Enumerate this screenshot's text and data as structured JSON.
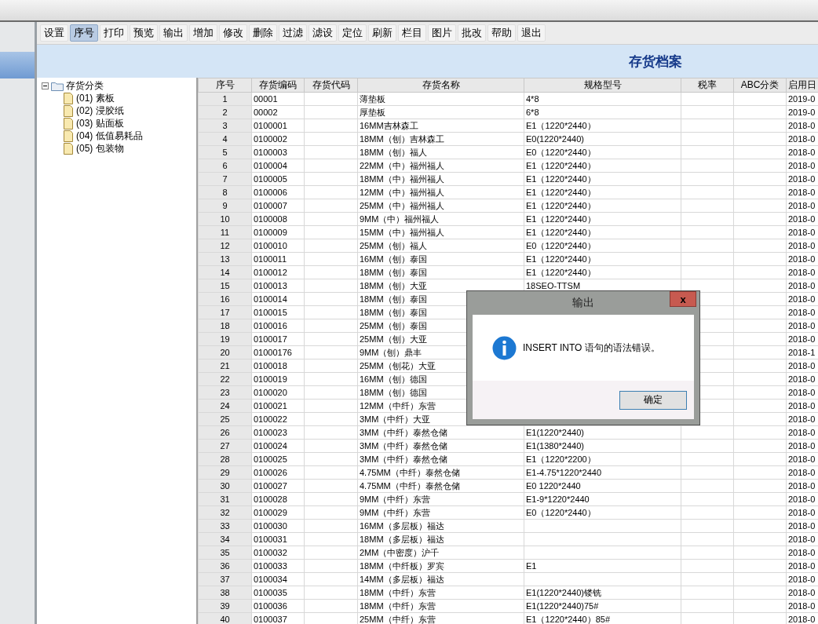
{
  "toolbar": [
    {
      "label": "设置",
      "selected": false
    },
    {
      "label": "序号",
      "selected": true
    },
    {
      "label": "打印",
      "selected": false
    },
    {
      "label": "预览",
      "selected": false
    },
    {
      "label": "输出",
      "selected": false
    },
    {
      "label": "增加",
      "selected": false
    },
    {
      "label": "修改",
      "selected": false
    },
    {
      "label": "删除",
      "selected": false
    },
    {
      "label": "过滤",
      "selected": false
    },
    {
      "label": "滤设",
      "selected": false
    },
    {
      "label": "定位",
      "selected": false
    },
    {
      "label": "刷新",
      "selected": false
    },
    {
      "label": "栏目",
      "selected": false
    },
    {
      "label": "图片",
      "selected": false
    },
    {
      "label": "批改",
      "selected": false
    },
    {
      "label": "帮助",
      "selected": false
    },
    {
      "label": "退出",
      "selected": false
    }
  ],
  "title": "存货档案",
  "tree": {
    "label": "存货分类",
    "expanded": true,
    "children": [
      {
        "code": "(01)",
        "label": "素板"
      },
      {
        "code": "(02)",
        "label": "浸胶纸"
      },
      {
        "code": "(03)",
        "label": "贴面板"
      },
      {
        "code": "(04)",
        "label": "低值易耗品"
      },
      {
        "code": "(05)",
        "label": "包装物"
      }
    ]
  },
  "table": {
    "columns": [
      "序号",
      "存货编码",
      "存货代码",
      "存货名称",
      "规格型号",
      "税率",
      "ABC分类",
      "启用日"
    ],
    "rows": [
      [
        "1",
        "00001",
        "",
        "薄垫板",
        "4*8",
        "",
        "",
        "2019-0"
      ],
      [
        "2",
        "00002",
        "",
        "厚垫板",
        "6*8",
        "",
        "",
        "2019-0"
      ],
      [
        "3",
        "0100001",
        "",
        "16MM吉林森工",
        "E1（1220*2440）",
        "",
        "",
        "2018-0"
      ],
      [
        "4",
        "0100002",
        "",
        "18MM（刨）吉林森工",
        "E0(1220*2440)",
        "",
        "",
        "2018-0"
      ],
      [
        "5",
        "0100003",
        "",
        "18MM（刨）福人",
        "E0（1220*2440）",
        "",
        "",
        "2018-0"
      ],
      [
        "6",
        "0100004",
        "",
        "22MM（中）福州福人",
        "E1（1220*2440）",
        "",
        "",
        "2018-0"
      ],
      [
        "7",
        "0100005",
        "",
        "18MM（中）福州福人",
        "E1（1220*2440）",
        "",
        "",
        "2018-0"
      ],
      [
        "8",
        "0100006",
        "",
        "12MM（中）福州福人",
        "E1（1220*2440）",
        "",
        "",
        "2018-0"
      ],
      [
        "9",
        "0100007",
        "",
        "25MM（中）福州福人",
        "E1（1220*2440）",
        "",
        "",
        "2018-0"
      ],
      [
        "10",
        "0100008",
        "",
        "9MM（中）福州福人",
        "E1（1220*2440）",
        "",
        "",
        "2018-0"
      ],
      [
        "11",
        "0100009",
        "",
        "15MM（中）福州福人",
        "E1（1220*2440）",
        "",
        "",
        "2018-0"
      ],
      [
        "12",
        "0100010",
        "",
        "25MM（刨）福人",
        "E0（1220*2440）",
        "",
        "",
        "2018-0"
      ],
      [
        "13",
        "0100011",
        "",
        "16MM（刨）泰国",
        "E1（1220*2440）",
        "",
        "",
        "2018-0"
      ],
      [
        "14",
        "0100012",
        "",
        "18MM（刨）泰国",
        "E1（1220*2440）",
        "",
        "",
        "2018-0"
      ],
      [
        "15",
        "0100013",
        "",
        "18MM（刨）大亚",
        "18SEO-TTSM",
        "",
        "",
        "2018-0"
      ],
      [
        "16",
        "0100014",
        "",
        "18MM（刨）泰国",
        "",
        "",
        "",
        "2018-0"
      ],
      [
        "17",
        "0100015",
        "",
        "18MM（刨）泰国",
        "",
        "",
        "",
        "2018-0"
      ],
      [
        "18",
        "0100016",
        "",
        "25MM（刨）泰国",
        "",
        "",
        "",
        "2018-0"
      ],
      [
        "19",
        "0100017",
        "",
        "25MM（刨）大亚",
        "",
        "",
        "",
        "2018-0"
      ],
      [
        "20",
        "01000176",
        "",
        "9MM（刨）鼎丰",
        "",
        "",
        "",
        "2018-1"
      ],
      [
        "21",
        "0100018",
        "",
        "25MM（刨花）大亚",
        "",
        "",
        "",
        "2018-0"
      ],
      [
        "22",
        "0100019",
        "",
        "16MM（刨）德国",
        "",
        "",
        "",
        "2018-0"
      ],
      [
        "23",
        "0100020",
        "",
        "18MM（刨）德国",
        "",
        "",
        "",
        "2018-0"
      ],
      [
        "24",
        "0100021",
        "",
        "12MM（中纤）东营",
        "",
        "",
        "",
        "2018-0"
      ],
      [
        "25",
        "0100022",
        "",
        "3MM（中纤）大亚",
        "",
        "",
        "",
        "2018-0"
      ],
      [
        "26",
        "0100023",
        "",
        "3MM（中纤）泰然仓储",
        "E1(1220*2440)",
        "",
        "",
        "2018-0"
      ],
      [
        "27",
        "0100024",
        "",
        "3MM（中纤）泰然仓储",
        "E1(1380*2440)",
        "",
        "",
        "2018-0"
      ],
      [
        "28",
        "0100025",
        "",
        "3MM（中纤）泰然仓储",
        "E1（1220*2200）",
        "",
        "",
        "2018-0"
      ],
      [
        "29",
        "0100026",
        "",
        "4.75MM（中纤）泰然仓储",
        "E1-4.75*1220*2440",
        "",
        "",
        "2018-0"
      ],
      [
        "30",
        "0100027",
        "",
        "4.75MM（中纤）泰然仓储",
        "E0 1220*2440",
        "",
        "",
        "2018-0"
      ],
      [
        "31",
        "0100028",
        "",
        "9MM（中纤）东营",
        "E1-9*1220*2440",
        "",
        "",
        "2018-0"
      ],
      [
        "32",
        "0100029",
        "",
        "9MM（中纤）东营",
        "E0（1220*2440）",
        "",
        "",
        "2018-0"
      ],
      [
        "33",
        "0100030",
        "",
        "16MM（多层板）福达",
        "",
        "",
        "",
        "2018-0"
      ],
      [
        "34",
        "0100031",
        "",
        "18MM（多层板）福达",
        "",
        "",
        "",
        "2018-0"
      ],
      [
        "35",
        "0100032",
        "",
        "2MM（中密度）沪千",
        "",
        "",
        "",
        "2018-0"
      ],
      [
        "36",
        "0100033",
        "",
        "18MM（中纤板）罗宾",
        "E1",
        "",
        "",
        "2018-0"
      ],
      [
        "37",
        "0100034",
        "",
        "14MM（多层板）福达",
        "",
        "",
        "",
        "2018-0"
      ],
      [
        "38",
        "0100035",
        "",
        "18MM（中纤）东营",
        "E1(1220*2440)镂铣",
        "",
        "",
        "2018-0"
      ],
      [
        "39",
        "0100036",
        "",
        "18MM（中纤）东营",
        "E1(1220*2440)75#",
        "",
        "",
        "2018-0"
      ],
      [
        "40",
        "0100037",
        "",
        "25MM（中纤）东营",
        "E1（1220*2440）85#",
        "",
        "",
        "2018-0"
      ]
    ]
  },
  "dialog": {
    "title": "输出",
    "close": "x",
    "message": "INSERT INTO 语句的语法错误。",
    "ok": "确定"
  }
}
